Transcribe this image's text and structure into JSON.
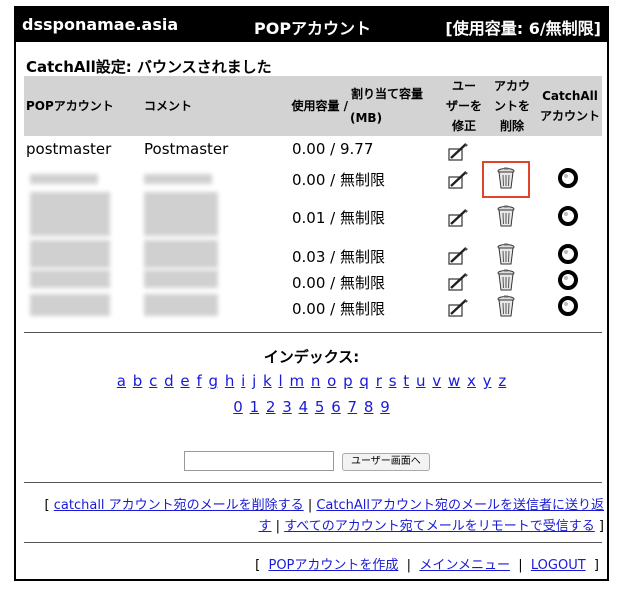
{
  "header": {
    "domain": "dssponamae.asia",
    "title": "POPアカウント",
    "usage": "[使用容量: 6/無制限]"
  },
  "subtitle": "CatchAll設定: バウンスされました",
  "table": {
    "columns": {
      "account": "POPアカウント",
      "comment": "コメント",
      "usage_line1": "割り当て容量",
      "usage_prefix": "使用容量 /",
      "usage_unit": "(MB)",
      "edit_line1": "ユー",
      "edit_line2": "ザーを",
      "edit_line3": "修正",
      "delete_line1": "アカウ",
      "delete_line2": "ントを",
      "delete_line3": "削除",
      "catchall_line1": "CatchAll",
      "catchall_line2": "アカウント"
    },
    "rows": [
      {
        "account": "postmaster",
        "comment": "Postmaster",
        "quota": "0.00 / 9.77"
      },
      {
        "account": "",
        "comment": "",
        "quota": "0.00 / 無制限"
      },
      {
        "account": "",
        "comment": "",
        "quota": "0.01 / 無制限"
      },
      {
        "account": "",
        "comment": "",
        "quota": "0.03 / 無制限"
      },
      {
        "account": "",
        "comment": "",
        "quota": "0.00 / 無制限"
      },
      {
        "account": "",
        "comment": "",
        "quota": "0.00 / 無制限"
      }
    ]
  },
  "index": {
    "title": "インデックス:",
    "letters": [
      "a",
      "b",
      "c",
      "d",
      "e",
      "f",
      "g",
      "h",
      "i",
      "j",
      "k",
      "l",
      "m",
      "n",
      "o",
      "p",
      "q",
      "r",
      "s",
      "t",
      "u",
      "v",
      "w",
      "x",
      "y",
      "z"
    ],
    "digits": [
      "0",
      "1",
      "2",
      "3",
      "4",
      "5",
      "6",
      "7",
      "8",
      "9"
    ]
  },
  "search": {
    "value": "",
    "button": "ユーザー画面へ"
  },
  "links1": {
    "open": "[",
    "delete_catchall": "catchall アカウント宛のメールを削除する",
    "sep1": "|",
    "return_catchall_a": "CatchAllアカウント宛のメールを送信者に送り返",
    "return_catchall_b": "す",
    "sep2": "|",
    "remote_receive": "すべてのアカウント宛てメールをリモートで受信する",
    "close": "]"
  },
  "links2": {
    "open": "[",
    "create": "POPアカウントを作成",
    "sep1": "|",
    "main_menu": "メインメニュー",
    "sep2": "|",
    "logout": "LOGOUT",
    "close": "]"
  },
  "colors": {
    "header_bg": "#000000",
    "table_header_bg": "#d3d3d3",
    "link": "#1a1ad6",
    "highlight": "#e0452a"
  }
}
